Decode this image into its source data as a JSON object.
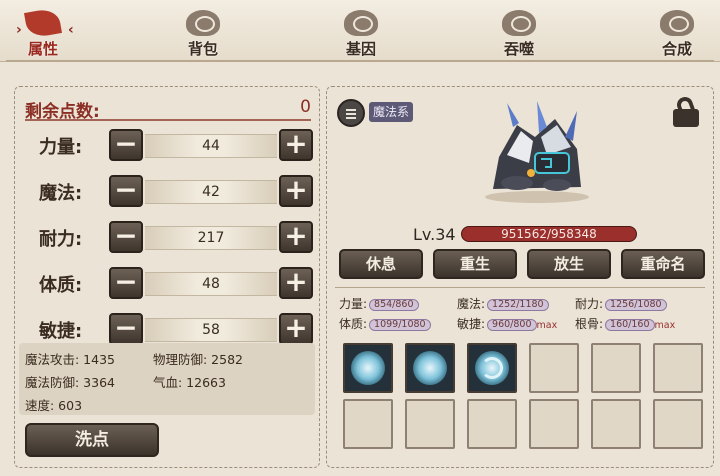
{
  "nav": {
    "tabs": [
      {
        "label": "属性",
        "icon": "attribute-flame-icon",
        "active": true
      },
      {
        "label": "背包",
        "icon": "bag-icon"
      },
      {
        "label": "基因",
        "icon": "gene-icon"
      },
      {
        "label": "吞噬",
        "icon": "devour-icon"
      },
      {
        "label": "合成",
        "icon": "synthesis-icon"
      }
    ],
    "prev_arrow": "›",
    "next_arrow": "‹"
  },
  "left": {
    "remaining_label": "剩余点数:",
    "remaining_value": "0",
    "stats": [
      {
        "name": "力量:",
        "value": "44"
      },
      {
        "name": "魔法:",
        "value": "42"
      },
      {
        "name": "耐力:",
        "value": "217"
      },
      {
        "name": "体质:",
        "value": "48"
      },
      {
        "name": "敏捷:",
        "value": "58"
      }
    ],
    "minus": "−",
    "plus": "+",
    "derived": {
      "magic_attack": "魔法攻击: 1435",
      "physical_defense": "物理防御: 2582",
      "magic_defense": "魔法防御: 3364",
      "hp": "气血: 12663",
      "speed": "速度: 603"
    },
    "wash_button": "洗点"
  },
  "right": {
    "element_tag": "魔法系",
    "level": "Lv.34",
    "hp": "951562/958348",
    "hp_fraction": 0.993,
    "actions": [
      "休息",
      "重生",
      "放生",
      "重命名"
    ],
    "growth": [
      {
        "label": "力量:",
        "value": "854/860"
      },
      {
        "label": "魔法:",
        "value": "1252/1180"
      },
      {
        "label": "耐力:",
        "value": "1256/1080"
      },
      {
        "label": "体质:",
        "value": "1099/1080"
      },
      {
        "label": "敏捷:",
        "value": "960/800",
        "max": "max"
      },
      {
        "label": "根骨:",
        "value": "160/160",
        "max": "max"
      }
    ],
    "slots": 12,
    "filled_skill_slots": 3
  },
  "colors": {
    "accent_red": "#8b2f25",
    "button_dark": "#3b332b",
    "hp_red": "#9a2f2b"
  }
}
